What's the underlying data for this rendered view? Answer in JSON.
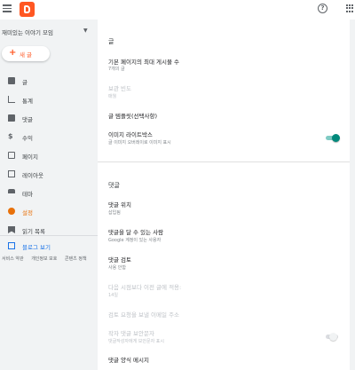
{
  "header": {
    "menu_icon": "hamburger-menu-icon",
    "logo_icon": "blogger-logo-icon",
    "help_glyph": "?",
    "apps_icon": "apps-grid-icon",
    "brand_color": "#ff5722"
  },
  "sidebar": {
    "blog_name": "재미있는 이야기 모임",
    "new_post_label": "새 글",
    "items": [
      {
        "label": "글",
        "icon": "posts-icon"
      },
      {
        "label": "통계",
        "icon": "stats-icon"
      },
      {
        "label": "댓글",
        "icon": "comments-icon"
      },
      {
        "label": "수익",
        "icon": "earnings-icon"
      },
      {
        "label": "페이지",
        "icon": "pages-icon"
      },
      {
        "label": "레이아웃",
        "icon": "layout-icon"
      },
      {
        "label": "테마",
        "icon": "theme-icon"
      },
      {
        "label": "설정",
        "icon": "settings-icon",
        "active": true
      },
      {
        "label": "읽기 목록",
        "icon": "reading-list-icon"
      }
    ],
    "view_blog_label": "블로그 보기",
    "footer_links": [
      "서비스 약관",
      "개인정보 보호",
      "콘텐츠 정책"
    ],
    "active_color": "#e8710a"
  },
  "main": {
    "posts_section": {
      "title": "글",
      "settings": [
        {
          "label": "기본 페이지의 최대 게시물 수",
          "value": "7개의 글"
        },
        {
          "label": "보관 빈도",
          "value": "매월",
          "disabled": true
        },
        {
          "label": "글 템플릿(선택사항)",
          "value": ""
        },
        {
          "label": "이미지 라이트박스",
          "value": "글 이미지 오버레이로 이미지 표시",
          "toggle": true
        }
      ]
    },
    "comments_section": {
      "title": "댓글",
      "settings": [
        {
          "label": "댓글 위치",
          "value": "삽입됨"
        },
        {
          "label": "댓글을 달 수 있는 사람",
          "value": "Google 계정이 있는 사용자"
        },
        {
          "label": "댓글 검토",
          "value": "사용 안함"
        },
        {
          "label": "다음 시점보다 이전 글에 적용:",
          "value": "14일",
          "disabled": true
        },
        {
          "label": "검토 요청을 보낼 이메일 주소",
          "value": "",
          "disabled": true
        },
        {
          "label": "작자 댓글 보안문자",
          "value": "댓글작성자에게 보안문자 표시",
          "disabled": true,
          "toggle": false
        },
        {
          "label": "댓글 양식 메시지",
          "value": ""
        }
      ]
    },
    "toggle_color": "#00897b"
  }
}
